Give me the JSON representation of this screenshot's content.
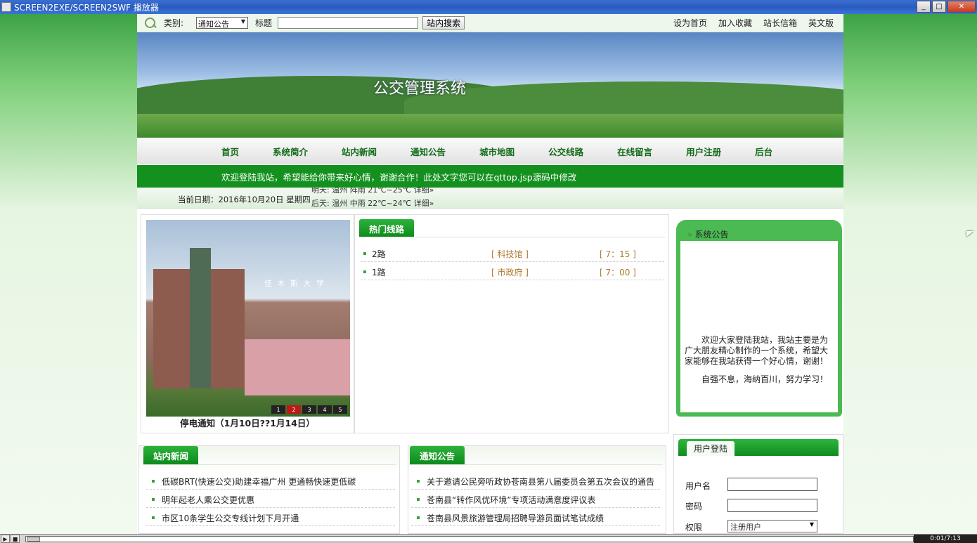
{
  "window": {
    "title": "SCREEN2EXE/SCREEN2SWF 播放器"
  },
  "topbar": {
    "category_label": "类别:",
    "category_value": "通知公告",
    "title_label": "标题",
    "search_button": "站内搜索",
    "links": [
      "设为首页",
      "加入收藏",
      "站长信箱",
      "英文版"
    ]
  },
  "banner": {
    "site_name": "公交管理系统"
  },
  "nav": {
    "items": [
      "首页",
      "系统简介",
      "站内新闻",
      "通知公告",
      "城市地图",
      "公交线路",
      "在线留言",
      "用户注册",
      "后台"
    ]
  },
  "marquee": {
    "text": "欢迎登陆我站，希望能给你带来好心情，谢谢合作！此处文字您可以在qttop.jsp源码中修改"
  },
  "datebar": {
    "date": "当前日期：2016年10月20日 星期四",
    "weather_line1": "明天: 温州  阵雨 21℃~25℃ 详细»",
    "weather_line2": "后天: 温州  中雨 22℃~24℃ 详细»"
  },
  "slideshow": {
    "image_text": "佳 木 斯 大 学",
    "pages": [
      "1",
      "2",
      "3",
      "4",
      "5"
    ],
    "active_page": "2",
    "caption": "停电通知（1月10日??1月14日）"
  },
  "hot_routes": {
    "title": "热门线路",
    "rows": [
      {
        "name": "2路",
        "stop": "[ 科技馆 ]",
        "time": "[ 7：15 ]"
      },
      {
        "name": "1路",
        "stop": "[ 市政府 ]",
        "time": "[ 7：00 ]"
      }
    ]
  },
  "system_notice": {
    "title": "系统公告",
    "text": "欢迎大家登陆我站，我站主要是为广大朋友精心制作的一个系统，希望大家能够在我站获得一个好心情，谢谢！",
    "motto": "自强不息，海纳百川，努力学习！"
  },
  "site_news": {
    "title": "站内新闻",
    "items": [
      "低碳BRT(快速公交)助建幸福广州 更通畅快速更低碳",
      "明年起老人乘公交更优惠",
      "市区10条学生公交专线计划下月开通"
    ]
  },
  "announcements": {
    "title": "通知公告",
    "items": [
      "关于邀请公民旁听政协苍南县第八届委员会第五次会议的通告",
      "苍南县“转作风优环境”专项活动满意度评议表",
      "苍南县风景旅游管理局招聘导游员面试笔试成绩"
    ]
  },
  "login": {
    "title": "用户登陆",
    "username_label": "用户名",
    "password_label": "密码",
    "role_label": "权限",
    "role_value": "注册用户"
  },
  "player": {
    "time": "0:01/7:13"
  }
}
